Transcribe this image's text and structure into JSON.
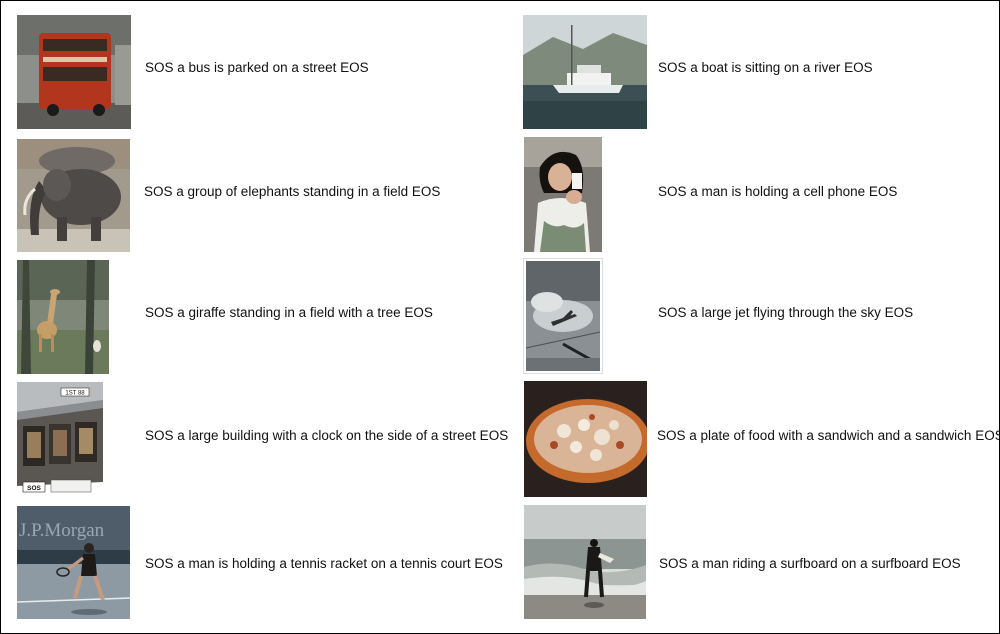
{
  "captions": [
    {
      "text": "SOS a bus is parked on a street EOS",
      "image": "double-decker-bus-photo"
    },
    {
      "text": "SOS a boat is sitting on a river EOS",
      "image": "yacht-harbor-photo"
    },
    {
      "text": "SOS a group of elephants standing in a field EOS",
      "image": "elephants-photo"
    },
    {
      "text": "SOS a man is holding a cell phone EOS",
      "image": "woman-with-camera-photo"
    },
    {
      "text": "SOS a giraffe standing in a field with a tree EOS",
      "image": "giraffe-photo"
    },
    {
      "text": "SOS a large jet flying through the sky EOS",
      "image": "jet-in-sky-photo"
    },
    {
      "text": "SOS a large building with a clock on the side of a street EOS",
      "image": "storefront-building-photo"
    },
    {
      "text": "SOS a plate of food with a sandwich and a sandwich EOS",
      "image": "pizza-photo"
    },
    {
      "text": "SOS a man is holding a tennis racket on a tennis court EOS",
      "image": "tennis-player-photo"
    },
    {
      "text": "SOS a man riding a surfboard on a surfboard EOS",
      "image": "surfer-on-beach-photo"
    }
  ],
  "logos": {
    "jpmorgan": "J.P.Morgan",
    "street_sign": "1ST 88",
    "sos_sign": "SOS"
  }
}
